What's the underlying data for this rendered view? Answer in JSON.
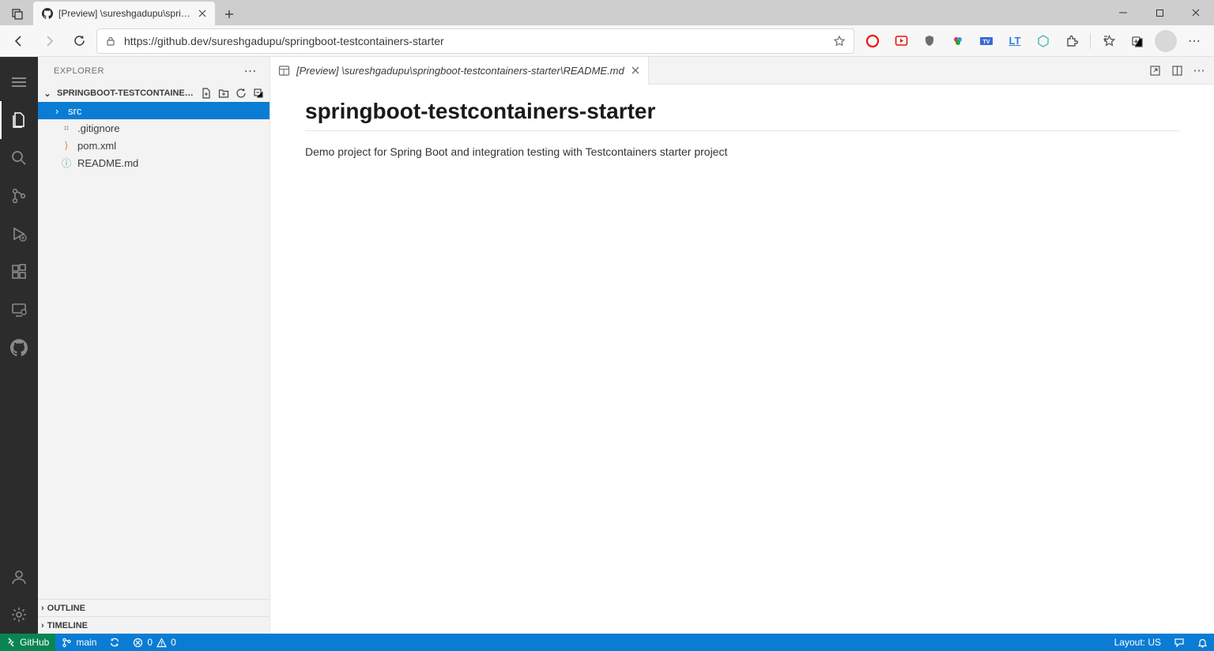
{
  "browser": {
    "tab_title": "[Preview] \\sureshgadupu\\springb",
    "url": "https://github.dev/sureshgadupu/springboot-testcontainers-starter"
  },
  "sidebar": {
    "title": "EXPLORER",
    "project_name": "SPRINGBOOT-TESTCONTAINERS...",
    "items": [
      {
        "type": "folder",
        "name": "src",
        "selected": true
      },
      {
        "type": "file",
        "name": ".gitignore",
        "icon": "gray"
      },
      {
        "type": "file",
        "name": "pom.xml",
        "icon": "orange"
      },
      {
        "type": "file",
        "name": "README.md",
        "icon": "blue"
      }
    ],
    "outline_label": "OUTLINE",
    "timeline_label": "TIMELINE"
  },
  "editor": {
    "tab_label": "[Preview] \\sureshgadupu\\springboot-testcontainers-starter\\README.md",
    "heading": "springboot-testcontainers-starter",
    "body": "Demo project for Spring Boot and integration testing with Testcontainers starter project"
  },
  "status": {
    "github": "GitHub",
    "branch": "main",
    "errors": "0",
    "warnings": "0",
    "layout": "Layout: US"
  }
}
